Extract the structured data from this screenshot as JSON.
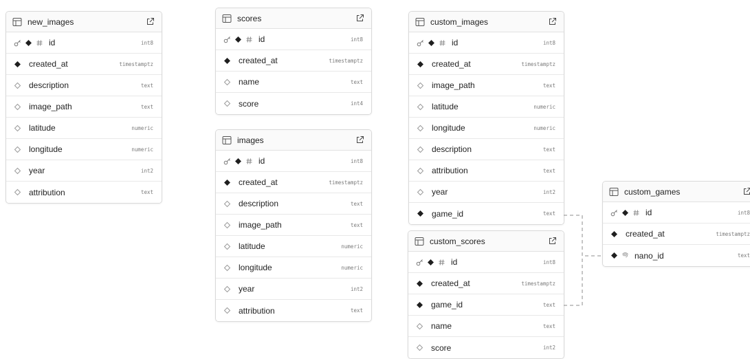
{
  "tables": [
    {
      "key": "new_images",
      "name": "new_images",
      "columns": [
        {
          "name": "id",
          "type": "int8",
          "markers": [
            "key",
            "filled",
            "hash"
          ]
        },
        {
          "name": "created_at",
          "type": "timestamptz",
          "markers": [
            "filled"
          ]
        },
        {
          "name": "description",
          "type": "text",
          "markers": [
            "outline"
          ]
        },
        {
          "name": "image_path",
          "type": "text",
          "markers": [
            "outline"
          ]
        },
        {
          "name": "latitude",
          "type": "numeric",
          "markers": [
            "outline"
          ]
        },
        {
          "name": "longitude",
          "type": "numeric",
          "markers": [
            "outline"
          ]
        },
        {
          "name": "year",
          "type": "int2",
          "markers": [
            "outline"
          ]
        },
        {
          "name": "attribution",
          "type": "text",
          "markers": [
            "outline"
          ]
        }
      ]
    },
    {
      "key": "scores",
      "name": "scores",
      "columns": [
        {
          "name": "id",
          "type": "int8",
          "markers": [
            "key",
            "filled",
            "hash"
          ]
        },
        {
          "name": "created_at",
          "type": "timestamptz",
          "markers": [
            "filled"
          ]
        },
        {
          "name": "name",
          "type": "text",
          "markers": [
            "outline"
          ]
        },
        {
          "name": "score",
          "type": "int4",
          "markers": [
            "outline"
          ]
        }
      ]
    },
    {
      "key": "images",
      "name": "images",
      "columns": [
        {
          "name": "id",
          "type": "int8",
          "markers": [
            "key",
            "filled",
            "hash"
          ]
        },
        {
          "name": "created_at",
          "type": "timestamptz",
          "markers": [
            "filled"
          ]
        },
        {
          "name": "description",
          "type": "text",
          "markers": [
            "outline"
          ]
        },
        {
          "name": "image_path",
          "type": "text",
          "markers": [
            "outline"
          ]
        },
        {
          "name": "latitude",
          "type": "numeric",
          "markers": [
            "outline"
          ]
        },
        {
          "name": "longitude",
          "type": "numeric",
          "markers": [
            "outline"
          ]
        },
        {
          "name": "year",
          "type": "int2",
          "markers": [
            "outline"
          ]
        },
        {
          "name": "attribution",
          "type": "text",
          "markers": [
            "outline"
          ]
        }
      ]
    },
    {
      "key": "custom_images",
      "name": "custom_images",
      "columns": [
        {
          "name": "id",
          "type": "int8",
          "markers": [
            "key",
            "filled",
            "hash"
          ]
        },
        {
          "name": "created_at",
          "type": "timestamptz",
          "markers": [
            "filled"
          ]
        },
        {
          "name": "image_path",
          "type": "text",
          "markers": [
            "outline"
          ]
        },
        {
          "name": "latitude",
          "type": "numeric",
          "markers": [
            "outline"
          ]
        },
        {
          "name": "longitude",
          "type": "numeric",
          "markers": [
            "outline"
          ]
        },
        {
          "name": "description",
          "type": "text",
          "markers": [
            "outline"
          ]
        },
        {
          "name": "attribution",
          "type": "text",
          "markers": [
            "outline"
          ]
        },
        {
          "name": "year",
          "type": "int2",
          "markers": [
            "outline"
          ]
        },
        {
          "name": "game_id",
          "type": "text",
          "markers": [
            "filled"
          ]
        }
      ]
    },
    {
      "key": "custom_scores",
      "name": "custom_scores",
      "columns": [
        {
          "name": "id",
          "type": "int8",
          "markers": [
            "key",
            "filled",
            "hash"
          ]
        },
        {
          "name": "created_at",
          "type": "timestamptz",
          "markers": [
            "filled"
          ]
        },
        {
          "name": "game_id",
          "type": "text",
          "markers": [
            "filled"
          ]
        },
        {
          "name": "name",
          "type": "text",
          "markers": [
            "outline"
          ]
        },
        {
          "name": "score",
          "type": "int2",
          "markers": [
            "outline"
          ]
        }
      ]
    },
    {
      "key": "custom_games",
      "name": "custom_games",
      "columns": [
        {
          "name": "id",
          "type": "int8",
          "markers": [
            "key",
            "filled",
            "hash"
          ]
        },
        {
          "name": "created_at",
          "type": "timestamptz",
          "markers": [
            "filled"
          ]
        },
        {
          "name": "nano_id",
          "type": "text",
          "markers": [
            "filled",
            "fingerprint"
          ]
        }
      ]
    }
  ],
  "colors": {
    "card_border": "#d9d9d9",
    "row_divider": "#e8e8e8",
    "text": "#1f1f1f",
    "type_text": "#7a7a7a",
    "marker": "#1f1f1f",
    "marker_outline": "#9a9a9a",
    "relation_line": "#8c8c8c"
  }
}
